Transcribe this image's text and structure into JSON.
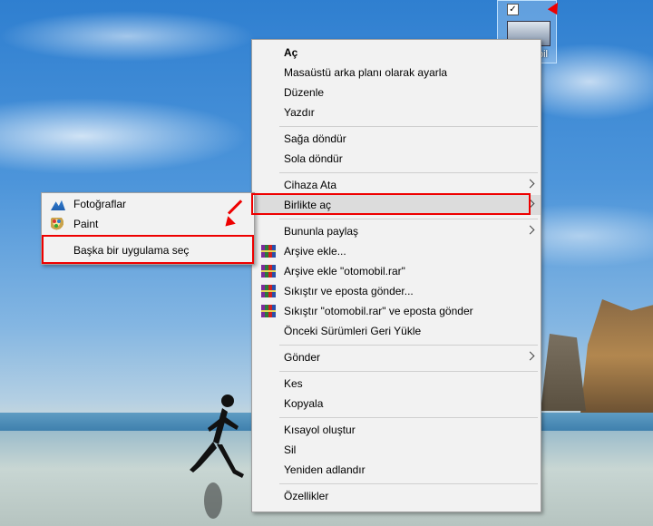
{
  "desktop_icon": {
    "label": "bil",
    "checked_mark": "✓"
  },
  "context_menu": {
    "items": [
      {
        "label": "Aç"
      },
      {
        "label": "Masaüstü arka planı olarak ayarla"
      },
      {
        "label": "Düzenle"
      },
      {
        "label": "Yazdır"
      },
      {
        "label": "Sağa döndür"
      },
      {
        "label": "Sola döndür"
      },
      {
        "label": "Cihaza Ata"
      },
      {
        "label": "Birlikte aç"
      },
      {
        "label": "Bununla paylaş"
      },
      {
        "label": "Arşive ekle..."
      },
      {
        "label": "Arşive ekle \"otomobil.rar\""
      },
      {
        "label": "Sıkıştır ve eposta gönder..."
      },
      {
        "label": "Sıkıştır \"otomobil.rar\" ve eposta gönder"
      },
      {
        "label": "Önceki Sürümleri Geri Yükle"
      },
      {
        "label": "Gönder"
      },
      {
        "label": "Kes"
      },
      {
        "label": "Kopyala"
      },
      {
        "label": "Kısayol oluştur"
      },
      {
        "label": "Sil"
      },
      {
        "label": "Yeniden adlandır"
      },
      {
        "label": "Özellikler"
      }
    ]
  },
  "submenu": {
    "items": [
      {
        "label": "Fotoğraflar",
        "icon": "photos-icon"
      },
      {
        "label": "Paint",
        "icon": "paint-icon"
      },
      {
        "label": "Başka bir uygulama seç"
      }
    ]
  },
  "colors": {
    "highlight_border": "#e00000",
    "menu_bg": "#f2f2f2",
    "hover_bg": "#dcdcdc"
  }
}
